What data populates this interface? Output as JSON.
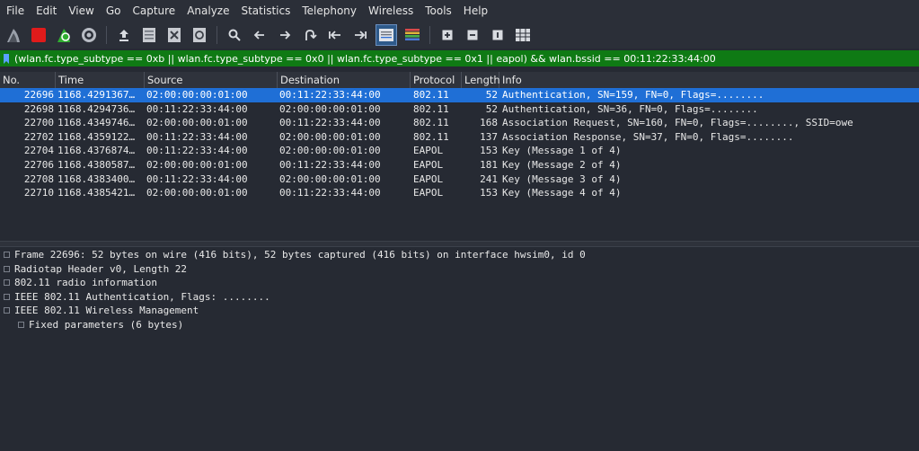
{
  "menu": [
    "File",
    "Edit",
    "View",
    "Go",
    "Capture",
    "Analyze",
    "Statistics",
    "Telephony",
    "Wireless",
    "Tools",
    "Help"
  ],
  "filter": {
    "value": "(wlan.fc.type_subtype == 0xb || wlan.fc.type_subtype == 0x0 || wlan.fc.type_subtype == 0x1 || eapol) && wlan.bssid == 00:11:22:33:44:00",
    "background": "#0f7a14"
  },
  "columns": [
    "No.",
    "Time",
    "Source",
    "Destination",
    "Protocol",
    "Length",
    "Info"
  ],
  "packets": [
    {
      "no": "22696",
      "time": "1168.4291367…",
      "src": "02:00:00:00:01:00",
      "dst": "00:11:22:33:44:00",
      "proto": "802.11",
      "len": "52",
      "info": "Authentication, SN=159, FN=0, Flags=........"
    },
    {
      "no": "22698",
      "time": "1168.4294736…",
      "src": "00:11:22:33:44:00",
      "dst": "02:00:00:00:01:00",
      "proto": "802.11",
      "len": "52",
      "info": "Authentication, SN=36, FN=0, Flags=........"
    },
    {
      "no": "22700",
      "time": "1168.4349746…",
      "src": "02:00:00:00:01:00",
      "dst": "00:11:22:33:44:00",
      "proto": "802.11",
      "len": "168",
      "info": "Association Request, SN=160, FN=0, Flags=........, SSID=owe"
    },
    {
      "no": "22702",
      "time": "1168.4359122…",
      "src": "00:11:22:33:44:00",
      "dst": "02:00:00:00:01:00",
      "proto": "802.11",
      "len": "137",
      "info": "Association Response, SN=37, FN=0, Flags=........"
    },
    {
      "no": "22704",
      "time": "1168.4376874…",
      "src": "00:11:22:33:44:00",
      "dst": "02:00:00:00:01:00",
      "proto": "EAPOL",
      "len": "153",
      "info": "Key (Message 1 of 4)"
    },
    {
      "no": "22706",
      "time": "1168.4380587…",
      "src": "02:00:00:00:01:00",
      "dst": "00:11:22:33:44:00",
      "proto": "EAPOL",
      "len": "181",
      "info": "Key (Message 2 of 4)"
    },
    {
      "no": "22708",
      "time": "1168.4383400…",
      "src": "00:11:22:33:44:00",
      "dst": "02:00:00:00:01:00",
      "proto": "EAPOL",
      "len": "241",
      "info": "Key (Message 3 of 4)"
    },
    {
      "no": "22710",
      "time": "1168.4385421…",
      "src": "02:00:00:00:01:00",
      "dst": "00:11:22:33:44:00",
      "proto": "EAPOL",
      "len": "153",
      "info": "Key (Message 4 of 4)"
    }
  ],
  "selected_packet": "22696",
  "selection_color": "#1f6fd6",
  "details": [
    {
      "label": "Frame 22696: 52 bytes on wire (416 bits), 52 bytes captured (416 bits) on interface hwsim0, id 0",
      "level": 0,
      "expandable": true
    },
    {
      "label": "Radiotap Header v0, Length 22",
      "level": 0,
      "expandable": true
    },
    {
      "label": "802.11 radio information",
      "level": 0,
      "expandable": true
    },
    {
      "label": "IEEE 802.11 Authentication, Flags: ........",
      "level": 0,
      "expandable": true
    },
    {
      "label": "IEEE 802.11 Wireless Management",
      "level": 0,
      "expandable": true
    },
    {
      "label": "Fixed parameters (6 bytes)",
      "level": 1,
      "expandable": true
    }
  ]
}
